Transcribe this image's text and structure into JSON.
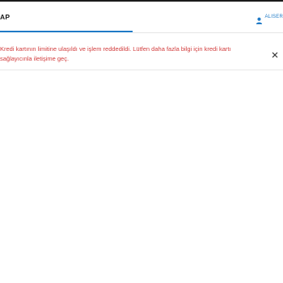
{
  "header": {
    "tab_label": "AP",
    "user": {
      "icon": "user-icon",
      "name": "ALISER"
    }
  },
  "alert": {
    "message": "Kredi kartının limitine ulaşıldı ve işlem reddedildi. Lütfen daha fazla bilgi için kredi kartı sağlayıcınla iletişime geç.",
    "close_icon": "close-icon"
  },
  "colors": {
    "accent": "#1f7ac6",
    "error_text": "#d23c3c",
    "top_border": "#1a1a1a"
  }
}
